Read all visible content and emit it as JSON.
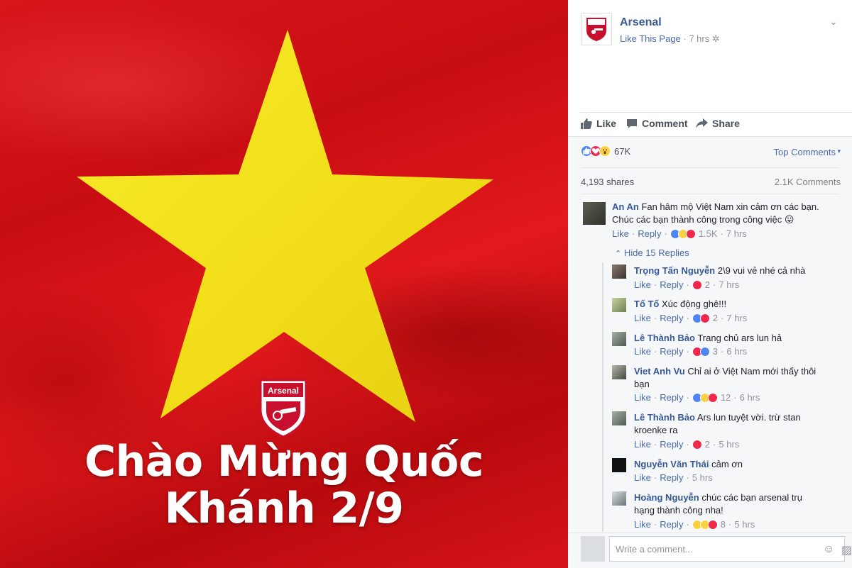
{
  "photo": {
    "headline_line1": "Chào Mừng Quốc",
    "headline_line2": "Khánh 2/9",
    "crest_text": "Arsenal",
    "colors": {
      "flag_red": "#d8171b",
      "star_yellow": "#f3e41d"
    }
  },
  "post": {
    "page_name": "Arsenal",
    "like_page": "Like This Page",
    "time": "7 hrs",
    "actions": {
      "like": "Like",
      "comment": "Comment",
      "share": "Share"
    },
    "reaction_count": "67K",
    "top_comments": "Top Comments",
    "shares": "4,193 shares",
    "comments_count": "2.1K Comments",
    "hide_replies": "Hide 15 Replies",
    "composer_placeholder": "Write a comment..."
  },
  "comments": [
    {
      "name": "An An",
      "text": "Fan hâm mộ Việt Nam xin cảm ơn các bạn.",
      "text2": "Chúc các bạn thành công trong công việc 😛",
      "like": "Like",
      "reply": "Reply",
      "count": "1.5K",
      "time": "7 hrs"
    },
    {
      "name": "Trọng Tấn Nguyễn",
      "text": "2\\9 vui vẻ nhé cả nhà",
      "like": "Like",
      "reply": "Reply",
      "count": "2",
      "time": "7 hrs"
    },
    {
      "name": "Tố Tố",
      "text": "Xúc động ghê!!!",
      "like": "Like",
      "reply": "Reply",
      "count": "2",
      "time": "7 hrs"
    },
    {
      "name": "Lê Thành Bảo",
      "text": "Trang chủ ars lun hả",
      "like": "Like",
      "reply": "Reply",
      "count": "3",
      "time": "6 hrs"
    },
    {
      "name": "Viet Anh Vu",
      "text": "Chỉ ai ở Việt Nam mới thấy thôi",
      "text2": "bạn",
      "like": "Like",
      "reply": "Reply",
      "count": "12",
      "time": "6 hrs"
    },
    {
      "name": "Lê Thành Bảo",
      "text": "Ars lun tuyệt vời. trừ stan",
      "text2": "kroenke ra",
      "like": "Like",
      "reply": "Reply",
      "count": "2",
      "time": "5 hrs"
    },
    {
      "name": "Nguyễn Văn Thái",
      "text": "cảm ơn",
      "like": "Like",
      "reply": "Reply",
      "count": "",
      "time": "5 hrs"
    },
    {
      "name": "Hoàng Nguyễn",
      "text": "chúc các bạn arsenal trụ",
      "text2": "hạng thành công nha!",
      "like": "Like",
      "reply": "Reply",
      "count": "8",
      "time": "5 hrs"
    }
  ]
}
